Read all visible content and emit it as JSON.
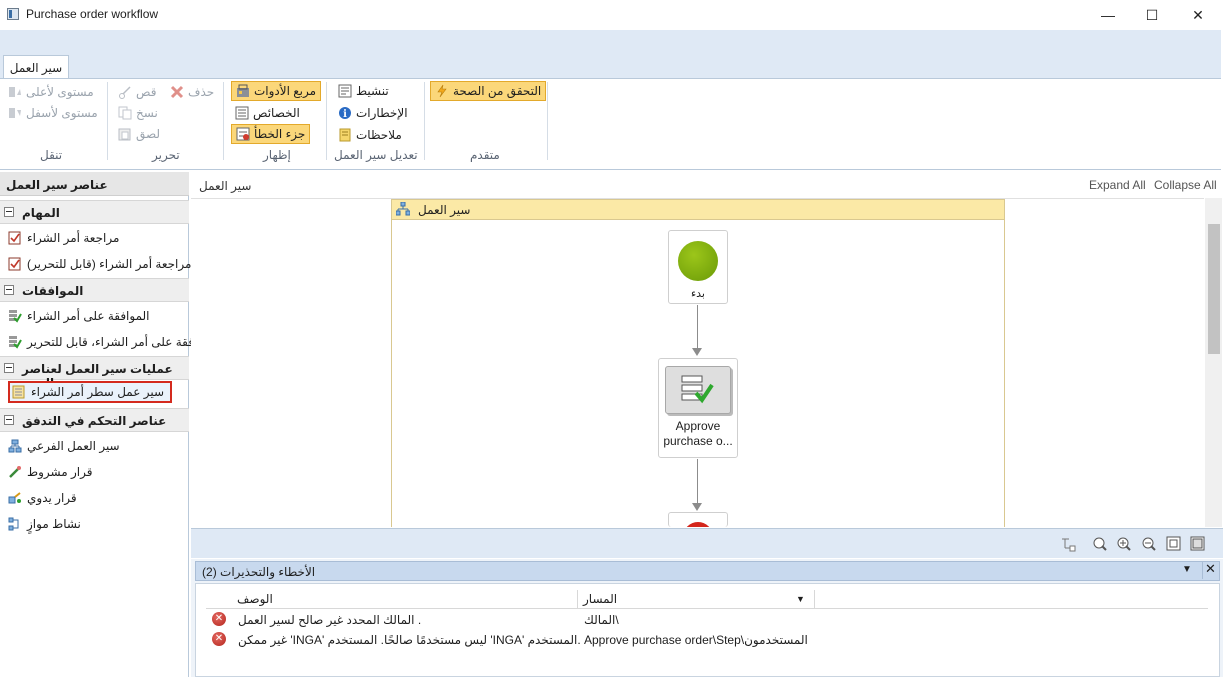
{
  "window": {
    "title": "Purchase order workflow",
    "minimize": "—",
    "maximize": "☐",
    "close": "✕"
  },
  "ribbon": {
    "tab": "سير العمل",
    "groups": {
      "navigate": {
        "label": "تنقل",
        "up": "مستوى لأعلى",
        "down": "مستوى لأسفل"
      },
      "edit": {
        "label": "تحرير",
        "delete": "حذف",
        "cut": "قص",
        "copy": "نسخ",
        "paste": "لصق"
      },
      "show": {
        "label": "إظهار",
        "toolbox": "مربع الأدوات",
        "properties": "الخصائص",
        "error_pane": "جزء الخطأ"
      },
      "modify": {
        "label": "تعديل سير العمل",
        "activate": "تنشيط",
        "notifications": "الإخطارات",
        "notes": "ملاحظات"
      },
      "advanced": {
        "label": "متقدم",
        "validate": "التحقق من الصحة"
      }
    }
  },
  "toolbox": {
    "title": "عناصر سير العمل",
    "sections": [
      {
        "label": "المهام",
        "items": [
          "مراجعة أمر الشراء",
          "(مراجعة أمر الشراء (قابل للتحرير"
        ]
      },
      {
        "label": "الموافقات",
        "items": [
          "الموافقة على أمر الشراء",
          "افقة على أمر الشراء، قابل للتحرير"
        ]
      },
      {
        "label": "عمليات سير العمل لعناصر البنود",
        "items": [
          "سير عمل سطر أمر الشراء"
        ]
      },
      {
        "label": "عناصر التحكم في التدفق",
        "items": [
          "سير العمل الفرعي",
          "قرار مشروط",
          "قرار يدوي",
          "نشاط موازٍ"
        ]
      }
    ]
  },
  "design": {
    "breadcrumb": "سير العمل",
    "expand_all": "Expand All",
    "collapse_all": "Collapse All",
    "workflow_title": "سير العمل",
    "start_label": "بدء",
    "approve_label": "Approve purchase o..."
  },
  "errors": {
    "title": "(الأخطاء والتحذيرات (2",
    "col_description": "الوصف",
    "col_path": "المسار",
    "rows": [
      {
        "description": "المالك المحدد غير صالح لسير العمل .",
        "path": "المالك\\"
      },
      {
        "description": "غير ممكن 'INGA' ليس مستخدمًا صالحًا. المستخدم 'INGA' المستخدم.",
        "path": "Approve purchase order\\Step\\المستخدمون"
      }
    ]
  },
  "colors": {
    "accent": "#fbd77a",
    "selection_border": "#d42a1e",
    "header_band": "#fbe9a6",
    "start_node": "#7ea80a"
  },
  "icons": [
    "up-icon",
    "down-icon",
    "delete-icon",
    "cut-icon",
    "copy-icon",
    "paste-icon",
    "toolbox-icon",
    "properties-icon",
    "error-pane-icon",
    "activate-icon",
    "notifications-icon",
    "notes-icon",
    "validate-icon",
    "task-icon",
    "approval-icon",
    "line-workflow-icon",
    "subworkflow-icon",
    "conditional-icon",
    "manual-icon",
    "parallel-icon",
    "zoom-icons",
    "error-icon"
  ]
}
